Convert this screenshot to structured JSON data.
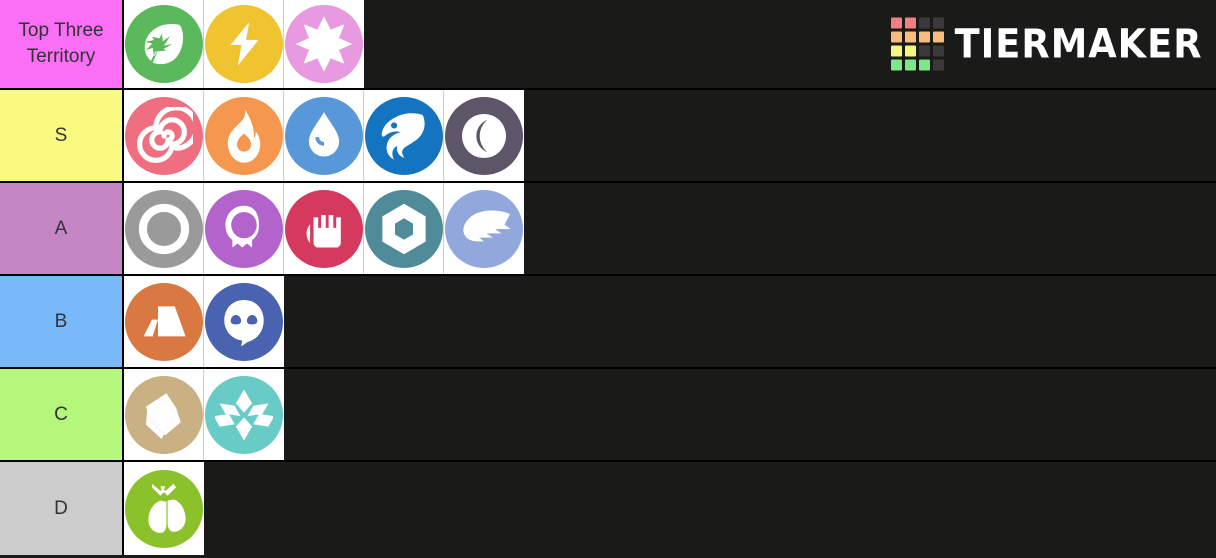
{
  "app": {
    "brand_name": "TIERMAKER",
    "brand_grid_colors": [
      "#f08080",
      "#f08080",
      "#3a3a3a",
      "#3a3a3a",
      "#f7bd7f",
      "#f7bd7f",
      "#f7bd7f",
      "#f7bd7f",
      "#f5f57f",
      "#f5f57f",
      "#3a3a3a",
      "#3a3a3a",
      "#7ee787",
      "#7ee787",
      "#7ee787",
      "#3a3a3a"
    ],
    "background_color": "#1a1a18"
  },
  "header": {
    "label": "Top Three Territory",
    "color": "#fa6ff5",
    "items": [
      {
        "name": "grass",
        "label": "Grass",
        "color": "#5cb85c"
      },
      {
        "name": "electric",
        "label": "Electric",
        "color": "#f0c330"
      },
      {
        "name": "fairy",
        "label": "Fairy",
        "color": "#e89ae0"
      }
    ]
  },
  "tiers": [
    {
      "label": "S",
      "color": "#fafa80",
      "items": [
        {
          "name": "poison",
          "label": "Poison",
          "color": "#ef6e7f"
        },
        {
          "name": "fire",
          "label": "Fire",
          "color": "#f5974e"
        },
        {
          "name": "water",
          "label": "Water",
          "color": "#5897d8"
        },
        {
          "name": "dragon",
          "label": "Dragon",
          "color": "#1574c0"
        },
        {
          "name": "dark",
          "label": "Dark",
          "color": "#5c5668"
        }
      ]
    },
    {
      "label": "A",
      "color": "#c486c4",
      "items": [
        {
          "name": "normal",
          "label": "Normal",
          "color": "#9a9a9a"
        },
        {
          "name": "ghost",
          "label": "Ghost",
          "color": "#b263cc"
        },
        {
          "name": "fighting",
          "label": "Fighting",
          "color": "#d53a5e"
        },
        {
          "name": "steel",
          "label": "Steel",
          "color": "#4f8b99"
        },
        {
          "name": "flying",
          "label": "Flying",
          "color": "#92a8dc"
        }
      ]
    },
    {
      "label": "B",
      "color": "#79b8f9",
      "items": [
        {
          "name": "ground",
          "label": "Ground",
          "color": "#da7842"
        },
        {
          "name": "psychic",
          "label": "Psychic",
          "color": "#4a63b0"
        }
      ]
    },
    {
      "label": "C",
      "color": "#b4f77a",
      "items": [
        {
          "name": "rock",
          "label": "Rock",
          "color": "#c9b183"
        },
        {
          "name": "ice",
          "label": "Ice",
          "color": "#69cbc5"
        }
      ]
    },
    {
      "label": "D",
      "color": "#cccccc",
      "items": [
        {
          "name": "bug",
          "label": "Bug",
          "color": "#8bc12a"
        }
      ]
    }
  ]
}
